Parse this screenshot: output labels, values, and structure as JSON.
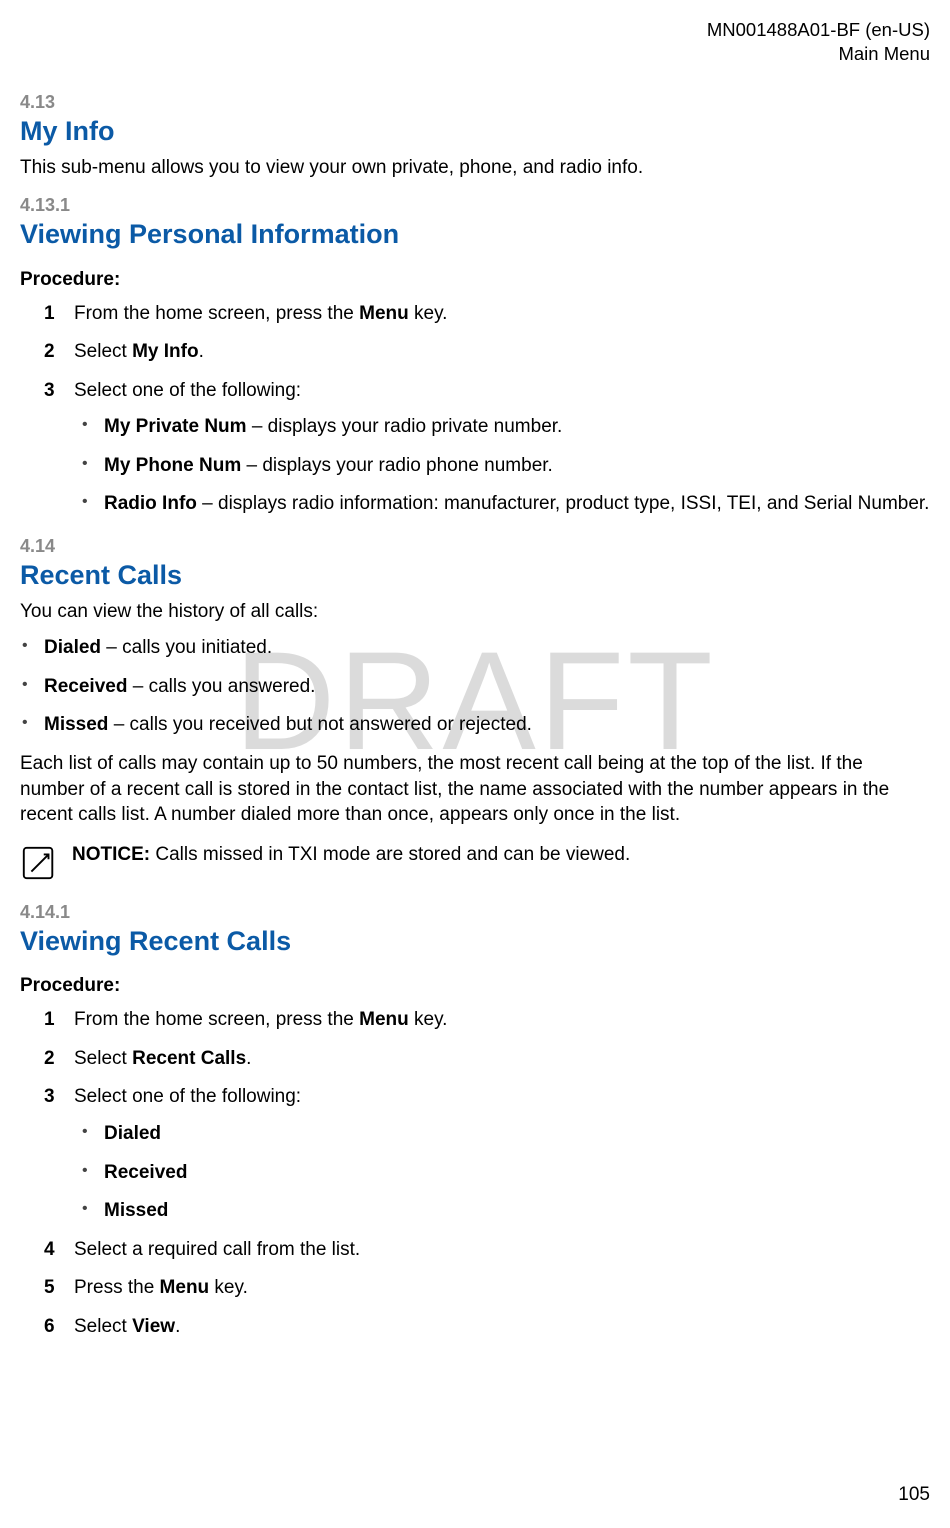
{
  "header": {
    "doc_id": "MN001488A01-BF (en-US)",
    "section_path": "Main Menu"
  },
  "watermark": "DRAFT",
  "page_number": "105",
  "s413": {
    "num": "4.13",
    "title": "My Info",
    "intro": "This sub-menu allows you to view your own private, phone, and radio info."
  },
  "s4131": {
    "num": "4.13.1",
    "title": "Viewing Personal Information",
    "proc_label": "Procedure:",
    "step1_a": "From the home screen, press the ",
    "step1_b": "Menu",
    "step1_c": " key.",
    "step2_a": "Select ",
    "step2_b": "My Info",
    "step2_c": ".",
    "step3": "Select one of the following:",
    "b1_a": "My Private Num",
    "b1_b": " – displays your radio private number.",
    "b2_a": "My Phone Num",
    "b2_b": " – displays your radio phone number.",
    "b3_a": "Radio Info",
    "b3_b": " – displays radio information: manufacturer, product type, ISSI, TEI, and Serial Number."
  },
  "s414": {
    "num": "4.14",
    "title": "Recent Calls",
    "intro": "You can view the history of all calls:",
    "b1_a": "Dialed",
    "b1_b": " – calls you initiated.",
    "b2_a": "Received",
    "b2_b": " – calls you answered.",
    "b3_a": "Missed",
    "b3_b": " – calls you received but not answered or rejected.",
    "para2": "Each list of calls may contain up to 50 numbers, the most recent call being at the top of the list. If the number of a recent call is stored in the contact list, the name associated with the number appears in the recent calls list. A number dialed more than once, appears only once in the list.",
    "notice_label": "NOTICE:",
    "notice_text": " Calls missed in TXI mode are stored and can be viewed."
  },
  "s4141": {
    "num": "4.14.1",
    "title": "Viewing Recent Calls",
    "proc_label": "Procedure:",
    "step1_a": "From the home screen, press the ",
    "step1_b": "Menu",
    "step1_c": " key.",
    "step2_a": "Select ",
    "step2_b": "Recent Calls",
    "step2_c": ".",
    "step3": "Select one of the following:",
    "b1": "Dialed",
    "b2": "Received",
    "b3": "Missed",
    "step4": "Select a required call from the list.",
    "step5_a": "Press the ",
    "step5_b": "Menu",
    "step5_c": " key.",
    "step6_a": "Select ",
    "step6_b": "View",
    "step6_c": "."
  }
}
